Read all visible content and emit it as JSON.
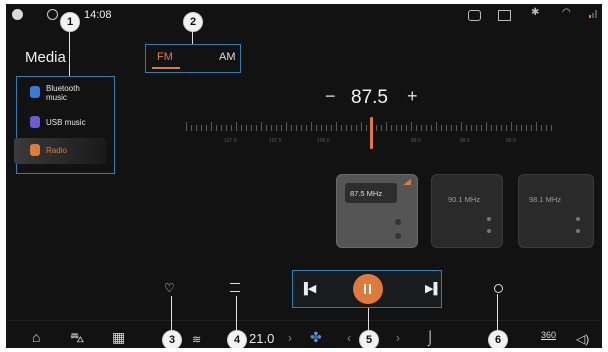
{
  "status": {
    "time": "14:08",
    "accent": "#e07a3a",
    "right_icons": [
      "camera-off-icon",
      "screen-icon",
      "bluetooth-icon",
      "wifi-icon",
      "signal-icon"
    ]
  },
  "page_title": "Media",
  "sidebar": {
    "items": [
      {
        "label_line1": "Bluetooth",
        "label_line2": "music",
        "icon": "bluetooth-icon",
        "color": "#3a7bd5"
      },
      {
        "label_line1": "USB music",
        "label_line2": "",
        "icon": "usb-icon",
        "color": "#6a5bd6"
      },
      {
        "label_line1": "Radio",
        "label_line2": "",
        "icon": "radio-icon",
        "color": "#e07a3a",
        "active": true
      }
    ]
  },
  "band_tabs": {
    "fm": "FM",
    "am": "AM",
    "selected": "FM"
  },
  "tuner": {
    "minus": "−",
    "frequency": "87.5",
    "plus": "+",
    "scale_labels": [
      "107.0",
      "107.5",
      "108.0",
      "88.0",
      "88.5",
      "89.0"
    ]
  },
  "presets": [
    {
      "freq": "87.5 MHz",
      "active": true
    },
    {
      "freq": "90.1 MHz",
      "active": false
    },
    {
      "freq": "98.1 MHz",
      "active": false
    }
  ],
  "callouts": [
    "1",
    "2",
    "3",
    "4",
    "5",
    "6"
  ],
  "bottom_bar": {
    "temperature": "21.0",
    "nav_360": "360"
  }
}
